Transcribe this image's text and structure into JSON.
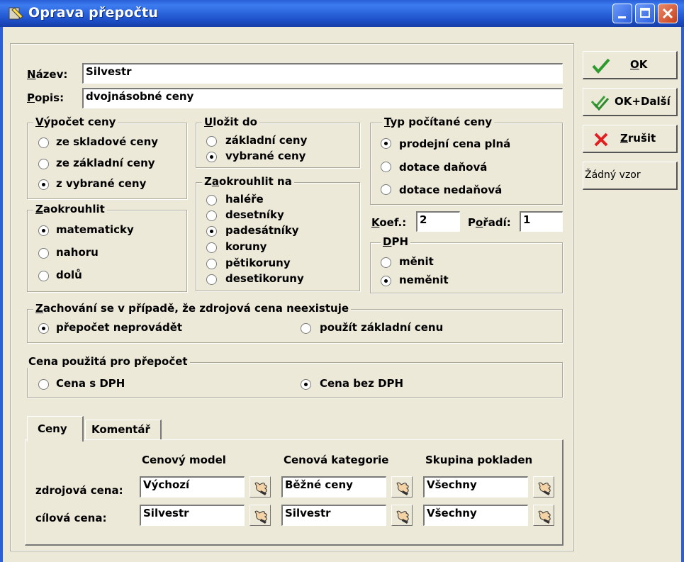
{
  "window": {
    "title": "Oprava přepočtu"
  },
  "nazev": {
    "label_u": "N",
    "label_rest": "ázev:",
    "value": "Silvestr"
  },
  "popis": {
    "label_u": "P",
    "label_rest": "opis:",
    "value": "dvojnásobné ceny"
  },
  "vypocet": {
    "title_u": "V",
    "title_rest": "ýpočet ceny",
    "options": [
      {
        "label": "ze skladové ceny",
        "selected": false
      },
      {
        "label": "ze základní ceny",
        "selected": false
      },
      {
        "label": "z vybrané ceny",
        "selected": true
      }
    ]
  },
  "zaokrouhlit": {
    "title_u": "Z",
    "title_rest": "aokrouhlit",
    "options": [
      {
        "label": "matematicky",
        "selected": true
      },
      {
        "label": "nahoru",
        "selected": false
      },
      {
        "label": "dolů",
        "selected": false
      }
    ]
  },
  "ulozit": {
    "title_u": "U",
    "title_rest": "ložit do",
    "options": [
      {
        "label": "základní ceny",
        "selected": false
      },
      {
        "label": "vybrané ceny",
        "selected": true
      }
    ]
  },
  "zaokrouhlit_na": {
    "title_pre": "Z",
    "title_u": "a",
    "title_rest": "okrouhlit na",
    "options": [
      {
        "label": "haléře",
        "selected": false
      },
      {
        "label": "desetníky",
        "selected": false
      },
      {
        "label": "padesátníky",
        "selected": true
      },
      {
        "label": "koruny",
        "selected": false
      },
      {
        "label": "pětikoruny",
        "selected": false
      },
      {
        "label": "desetikoruny",
        "selected": false
      }
    ]
  },
  "typ": {
    "title_u": "T",
    "title_rest": "yp počítané ceny",
    "options": [
      {
        "label": "prodejní cena plná",
        "selected": true
      },
      {
        "label": "dotace daňová",
        "selected": false
      },
      {
        "label": "dotace nedaňová",
        "selected": false
      }
    ]
  },
  "koef": {
    "label_u": "K",
    "label_rest": "oef.:",
    "value": "2"
  },
  "poradi": {
    "label_pre": "P",
    "label_u": "o",
    "label_rest": "řadí:",
    "value": "1"
  },
  "dph": {
    "title_u": "D",
    "title_rest": "PH",
    "options": [
      {
        "label": "měnit",
        "selected": false
      },
      {
        "label": "neměnit",
        "selected": true
      }
    ]
  },
  "zachovani": {
    "title_u": "Z",
    "title_rest": "achování se v případě, že zdrojová cena neexistuje",
    "options": [
      {
        "label": "přepočet neprovádět",
        "selected": true
      },
      {
        "label": "použít základní cenu",
        "selected": false
      }
    ]
  },
  "cena_pouzita": {
    "title": "Cena použitá pro přepočet",
    "options": [
      {
        "label": "Cena s DPH",
        "selected": false
      },
      {
        "label": "Cena bez DPH",
        "selected": true
      }
    ]
  },
  "buttons": {
    "ok_u": "O",
    "ok_rest": "K",
    "ok_dalsi": "OK+Další",
    "zrusit_u": "Z",
    "zrusit_rest": "rušit",
    "vzor": "Žádný vzor"
  },
  "tabs": [
    {
      "label": "Ceny",
      "active": true
    },
    {
      "label": "Komentář",
      "active": false
    }
  ],
  "prices": {
    "columns": [
      "Cenový model",
      "Cenová kategorie",
      "Skupina pokladen"
    ],
    "rows": [
      {
        "label": "zdrojová cena:",
        "values": [
          "Výchozí",
          "Běžné ceny",
          "Všechny"
        ]
      },
      {
        "label": "cílová cena:",
        "values": [
          "Silvestr",
          "Silvestr",
          "Všechny"
        ]
      }
    ]
  },
  "colors": {
    "titlebar": "#2a5fd8",
    "dialog_bg": "#ece9d8",
    "ok_check": "#2e9a2e",
    "cancel_x": "#e02020"
  }
}
